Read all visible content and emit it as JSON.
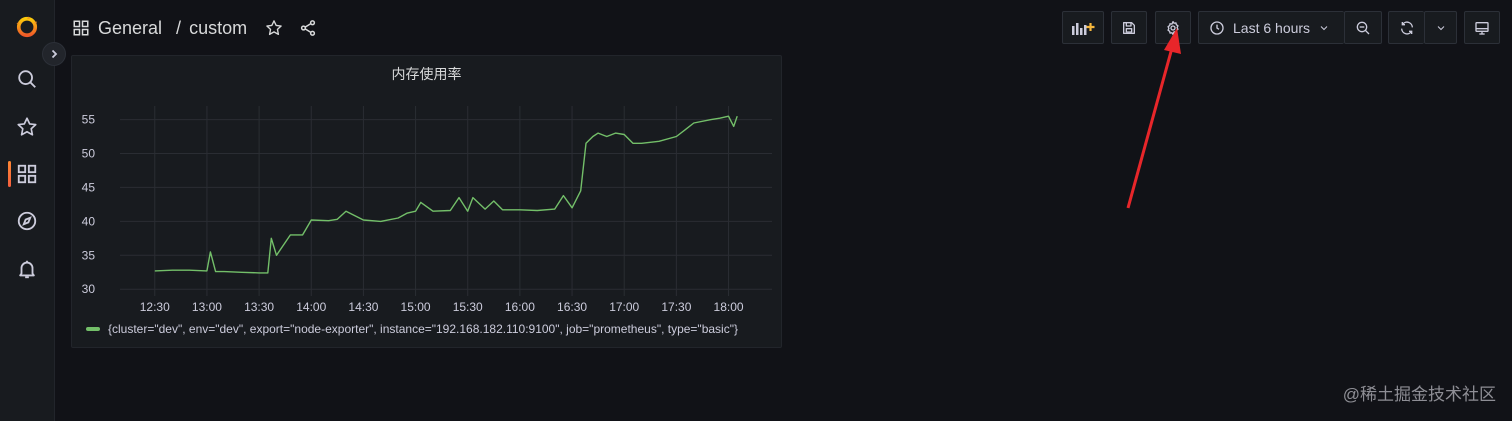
{
  "breadcrumb": {
    "folder": "General",
    "dashboard": "custom"
  },
  "toolbar": {
    "time_range": "Last 6 hours"
  },
  "panel": {
    "title": "内存使用率",
    "legend": "{cluster=\"dev\", env=\"dev\", export=\"node-exporter\", instance=\"192.168.182.110:9100\", job=\"prometheus\", type=\"basic\"}"
  },
  "chart_data": {
    "type": "line",
    "title": "内存使用率",
    "xlabel": "",
    "ylabel": "",
    "x_ticks": [
      "12:30",
      "13:00",
      "13:30",
      "14:00",
      "14:30",
      "15:00",
      "15:30",
      "16:00",
      "16:30",
      "17:00",
      "17:30",
      "18:00"
    ],
    "y_ticks": [
      30,
      35,
      40,
      45,
      50,
      55
    ],
    "xlim": [
      "12:10",
      "18:25"
    ],
    "ylim": [
      29,
      57
    ],
    "grid": true,
    "legend_position": "bottom",
    "series": [
      {
        "color": "#73bf69",
        "x": [
          "12:30",
          "12:40",
          "12:50",
          "13:00",
          "13:02",
          "13:05",
          "13:10",
          "13:20",
          "13:30",
          "13:35",
          "13:37",
          "13:40",
          "13:48",
          "13:55",
          "14:00",
          "14:10",
          "14:15",
          "14:20",
          "14:30",
          "14:40",
          "14:50",
          "14:55",
          "15:00",
          "15:03",
          "15:10",
          "15:20",
          "15:25",
          "15:30",
          "15:33",
          "15:40",
          "15:45",
          "15:50",
          "16:00",
          "16:10",
          "16:20",
          "16:25",
          "16:30",
          "16:35",
          "16:38",
          "16:42",
          "16:45",
          "16:50",
          "16:55",
          "17:00",
          "17:05",
          "17:10",
          "17:20",
          "17:30",
          "17:35",
          "17:40",
          "17:50",
          "17:55",
          "18:00",
          "18:03",
          "18:05"
        ],
        "y": [
          32.7,
          32.8,
          32.8,
          32.7,
          35.5,
          32.6,
          32.6,
          32.5,
          32.4,
          32.4,
          37.5,
          35.0,
          38.0,
          38.0,
          40.2,
          40.1,
          40.3,
          41.5,
          40.2,
          40.0,
          40.5,
          41.2,
          41.5,
          42.8,
          41.5,
          41.6,
          43.5,
          41.5,
          43.5,
          41.8,
          43.0,
          41.7,
          41.7,
          41.6,
          41.8,
          43.8,
          42.0,
          44.5,
          51.5,
          52.5,
          53.0,
          52.5,
          53.0,
          52.8,
          51.5,
          51.5,
          51.8,
          52.5,
          53.5,
          54.5,
          55.0,
          55.2,
          55.5,
          54.0,
          55.5
        ]
      }
    ]
  },
  "watermark": "@稀土掘金技术社区"
}
